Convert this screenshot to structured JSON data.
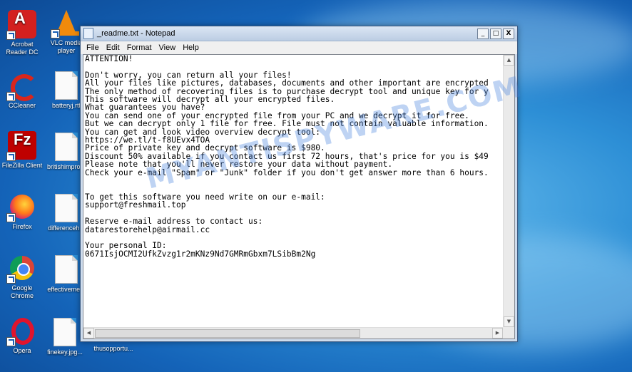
{
  "desktop": {
    "icons": [
      {
        "label": "Acrobat Reader DC"
      },
      {
        "label": "VLC media player"
      },
      {
        "label": "CCleaner"
      },
      {
        "label": "batteryj.rtf"
      },
      {
        "label": "FileZilla Client"
      },
      {
        "label": "britishimpro..."
      },
      {
        "label": "Firefox"
      },
      {
        "label": "differenceh..."
      },
      {
        "label": "Google Chrome"
      },
      {
        "label": "effectiveme..."
      },
      {
        "label": "Opera"
      },
      {
        "label": "finekey.jpg..."
      },
      {
        "label": "thusopportu..."
      }
    ]
  },
  "window": {
    "title": "_readme.txt - Notepad",
    "minimize": "_",
    "maximize": "□",
    "close": "X"
  },
  "menu": {
    "file": "File",
    "edit": "Edit",
    "format": "Format",
    "view": "View",
    "help": "Help"
  },
  "document": {
    "text": "ATTENTION!\n\nDon't worry, you can return all your files!\nAll your files like pictures, databases, documents and other important are encrypted\nThe only method of recovering files is to purchase decrypt tool and unique key for y\nThis software will decrypt all your encrypted files.\nWhat guarantees you have?\nYou can send one of your encrypted file from your PC and we decrypt it for free.\nBut we can decrypt only 1 file for free. File must not contain valuable information.\nYou can get and look video overview decrypt tool:\nhttps://we.tl/t-f8UEvx4TOA\nPrice of private key and decrypt software is $980.\nDiscount 50% available if you contact us first 72 hours, that's price for you is $49\nPlease note that you'll never restore your data without payment.\nCheck your e-mail \"Spam\" or \"Junk\" folder if you don't get answer more than 6 hours.\n\n\nTo get this software you need write on our e-mail:\nsupport@freshmail.top\n\nReserve e-mail address to contact us:\ndatarestorehelp@airmail.cc\n\nYour personal ID:\n0671IsjOCMI2UfkZvzg1r2mKNz9Nd7GMRmGbxm7LSibBm2Ng"
  },
  "watermark": "MYANTISPYWARE.COM"
}
